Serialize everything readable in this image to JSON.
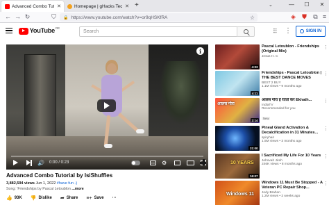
{
  "browser": {
    "tabs": [
      {
        "title": "Advanced Combo Tutorial by Is",
        "active": true,
        "favicon_color": "#ff0000"
      },
      {
        "title": "Homepage | gHacks Technolog",
        "active": false,
        "favicon_color": "#f4a11e"
      }
    ],
    "new_tab": "+",
    "tab_list": "⌄",
    "window_controls": {
      "minimize": "—",
      "maximize": "☐",
      "close": "✕"
    },
    "url": "https://www.youtube.com/watch?v=or9qHSKfRA",
    "nav": {
      "back": "←",
      "forward": "→",
      "reload": "↻",
      "shield": "⛉"
    }
  },
  "youtube": {
    "logo_text": "YouTube",
    "logo_country": "DE",
    "search_placeholder": "Search",
    "signin_label": "SIGN IN"
  },
  "player": {
    "time": "0:00 / 0:23",
    "info_label": "i",
    "cc_label": "CC"
  },
  "video": {
    "title": "Advanced Combo Tutorial by IsiShuffles",
    "views": "3,882,594 views",
    "date": "Jun 1, 2022",
    "hashtag": "#have fun -)",
    "song": "Song: 'Friendships by Pascal Letoublon",
    "more": "...more",
    "actions": {
      "likes": "93K",
      "dislike": "Dislike",
      "share": "Share",
      "save": "Save",
      "more": "···"
    }
  },
  "recommendations": [
    {
      "title": "Pascal Letoublon - Friendships (Original Mix)",
      "channel": "Jesus H. C",
      "views": "",
      "duration": "4:03",
      "badge": ""
    },
    {
      "title": "Friendships - Pascal Letoublon | THE BEST DANCE MOVES",
      "channel": "BEST 2 BUY",
      "views": "1.1M views • 9 months ago",
      "duration": "4:11",
      "badge": ""
    },
    {
      "title": "आलस गोरा हे रेतेतो कर Ekhath...",
      "channel": "IndiaTV",
      "views": "Recommended for you",
      "duration": "2:14",
      "badge": "New",
      "thumb_text": "आलस गोरा"
    },
    {
      "title": "Pineal Gland Activation & Decalcification in 31 Minutes...",
      "channel": "spiryhair",
      "views": "1.5M views • 3 months ago",
      "duration": "31:00",
      "badge": ""
    },
    {
      "title": "I Sacrificed My Life For 10 Years",
      "channel": "Jehovah Jireh",
      "views": "246K views • 8 months ago",
      "duration": "16:07",
      "badge": "",
      "thumb_text": "10 YEARS"
    },
    {
      "title": "Windows 11 Must Be Stopped - A Veteran PC Repair Shop...",
      "channel": "Jody Brahon",
      "views": "1.2M views • 2 weeks ago",
      "duration": "",
      "badge": "",
      "thumb_text": "Windows 11"
    }
  ]
}
